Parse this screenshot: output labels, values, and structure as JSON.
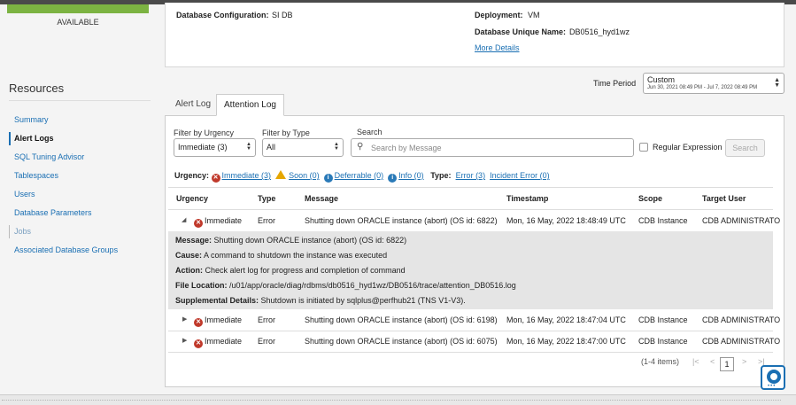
{
  "status": {
    "label": "AVAILABLE",
    "color": "#7cb342"
  },
  "resources": {
    "title": "Resources",
    "items": [
      {
        "label": "Summary",
        "state": "link"
      },
      {
        "label": "Alert Logs",
        "state": "active"
      },
      {
        "label": "SQL Tuning Advisor",
        "state": "link"
      },
      {
        "label": "Tablespaces",
        "state": "link"
      },
      {
        "label": "Users",
        "state": "link"
      },
      {
        "label": "Database Parameters",
        "state": "link"
      },
      {
        "label": "Jobs",
        "state": "muted"
      },
      {
        "label": "Associated Database Groups",
        "state": "link"
      }
    ]
  },
  "info": {
    "db_config_label": "Database Configuration:",
    "db_config_value": "SI DB",
    "deployment_label": "Deployment:",
    "deployment_value": "VM",
    "unique_name_label": "Database Unique Name:",
    "unique_name_value": "DB0516_hyd1wz",
    "more_details": "More Details"
  },
  "time_period": {
    "label": "Time Period",
    "value": "Custom",
    "range": "Jun 30, 2021 08:49 PM - Jul 7, 2022 08:49 PM"
  },
  "tabs": {
    "alert_log": "Alert Log",
    "attention_log": "Attention Log",
    "selected": "Attention Log"
  },
  "filters": {
    "urgency_label": "Filter by Urgency",
    "urgency_value": "Immediate (3)",
    "type_label": "Filter by Type",
    "type_value": "All",
    "search_label": "Search",
    "search_placeholder": "Search by Message",
    "regex_label": "Regular Expression",
    "search_button": "Search"
  },
  "summary": {
    "urgency_label": "Urgency:",
    "immediate": "Immediate (3)",
    "soon": "Soon (0)",
    "deferrable": "Deferrable (0)",
    "info": "Info (0)",
    "type_label": "Type:",
    "error": "Error (3)",
    "incident_error": "Incident Error (0)"
  },
  "table": {
    "headers": {
      "urgency": "Urgency",
      "type": "Type",
      "message": "Message",
      "timestamp": "Timestamp",
      "scope": "Scope",
      "target_user": "Target User"
    },
    "rows": [
      {
        "urgency": "Immediate",
        "type": "Error",
        "message": "Shutting down ORACLE instance (abort) (OS id: 6822)",
        "timestamp": "Mon, 16 May, 2022 18:48:49 UTC",
        "scope": "CDB Instance",
        "target_user": "CDB ADMINISTRATO"
      },
      {
        "urgency": "Immediate",
        "type": "Error",
        "message": "Shutting down ORACLE instance (abort) (OS id: 6198)",
        "timestamp": "Mon, 16 May, 2022 18:47:04 UTC",
        "scope": "CDB Instance",
        "target_user": "CDB ADMINISTRATO"
      },
      {
        "urgency": "Immediate",
        "type": "Error",
        "message": "Shutting down ORACLE instance (abort) (OS id: 6075)",
        "timestamp": "Mon, 16 May, 2022 18:47:00 UTC",
        "scope": "CDB Instance",
        "target_user": "CDB ADMINISTRATO"
      }
    ],
    "detail": {
      "message_label": "Message:",
      "message": "Shutting down ORACLE instance (abort) (OS id: 6822)",
      "cause_label": "Cause:",
      "cause": "A command to shutdown the instance was executed",
      "action_label": "Action:",
      "action": "Check alert log for progress and completion of command",
      "file_label": "File Location:",
      "file": "/u01/app/oracle/diag/rdbms/db0516_hyd1wz/DB0516/trace/attention_DB0516.log",
      "supp_label": "Supplemental Details:",
      "supp": "Shutdown is initiated by sqlplus@perfhub21 (TNS V1-V3)."
    }
  },
  "pagination": {
    "summary": "(1-4 items)",
    "current_page": "1"
  }
}
